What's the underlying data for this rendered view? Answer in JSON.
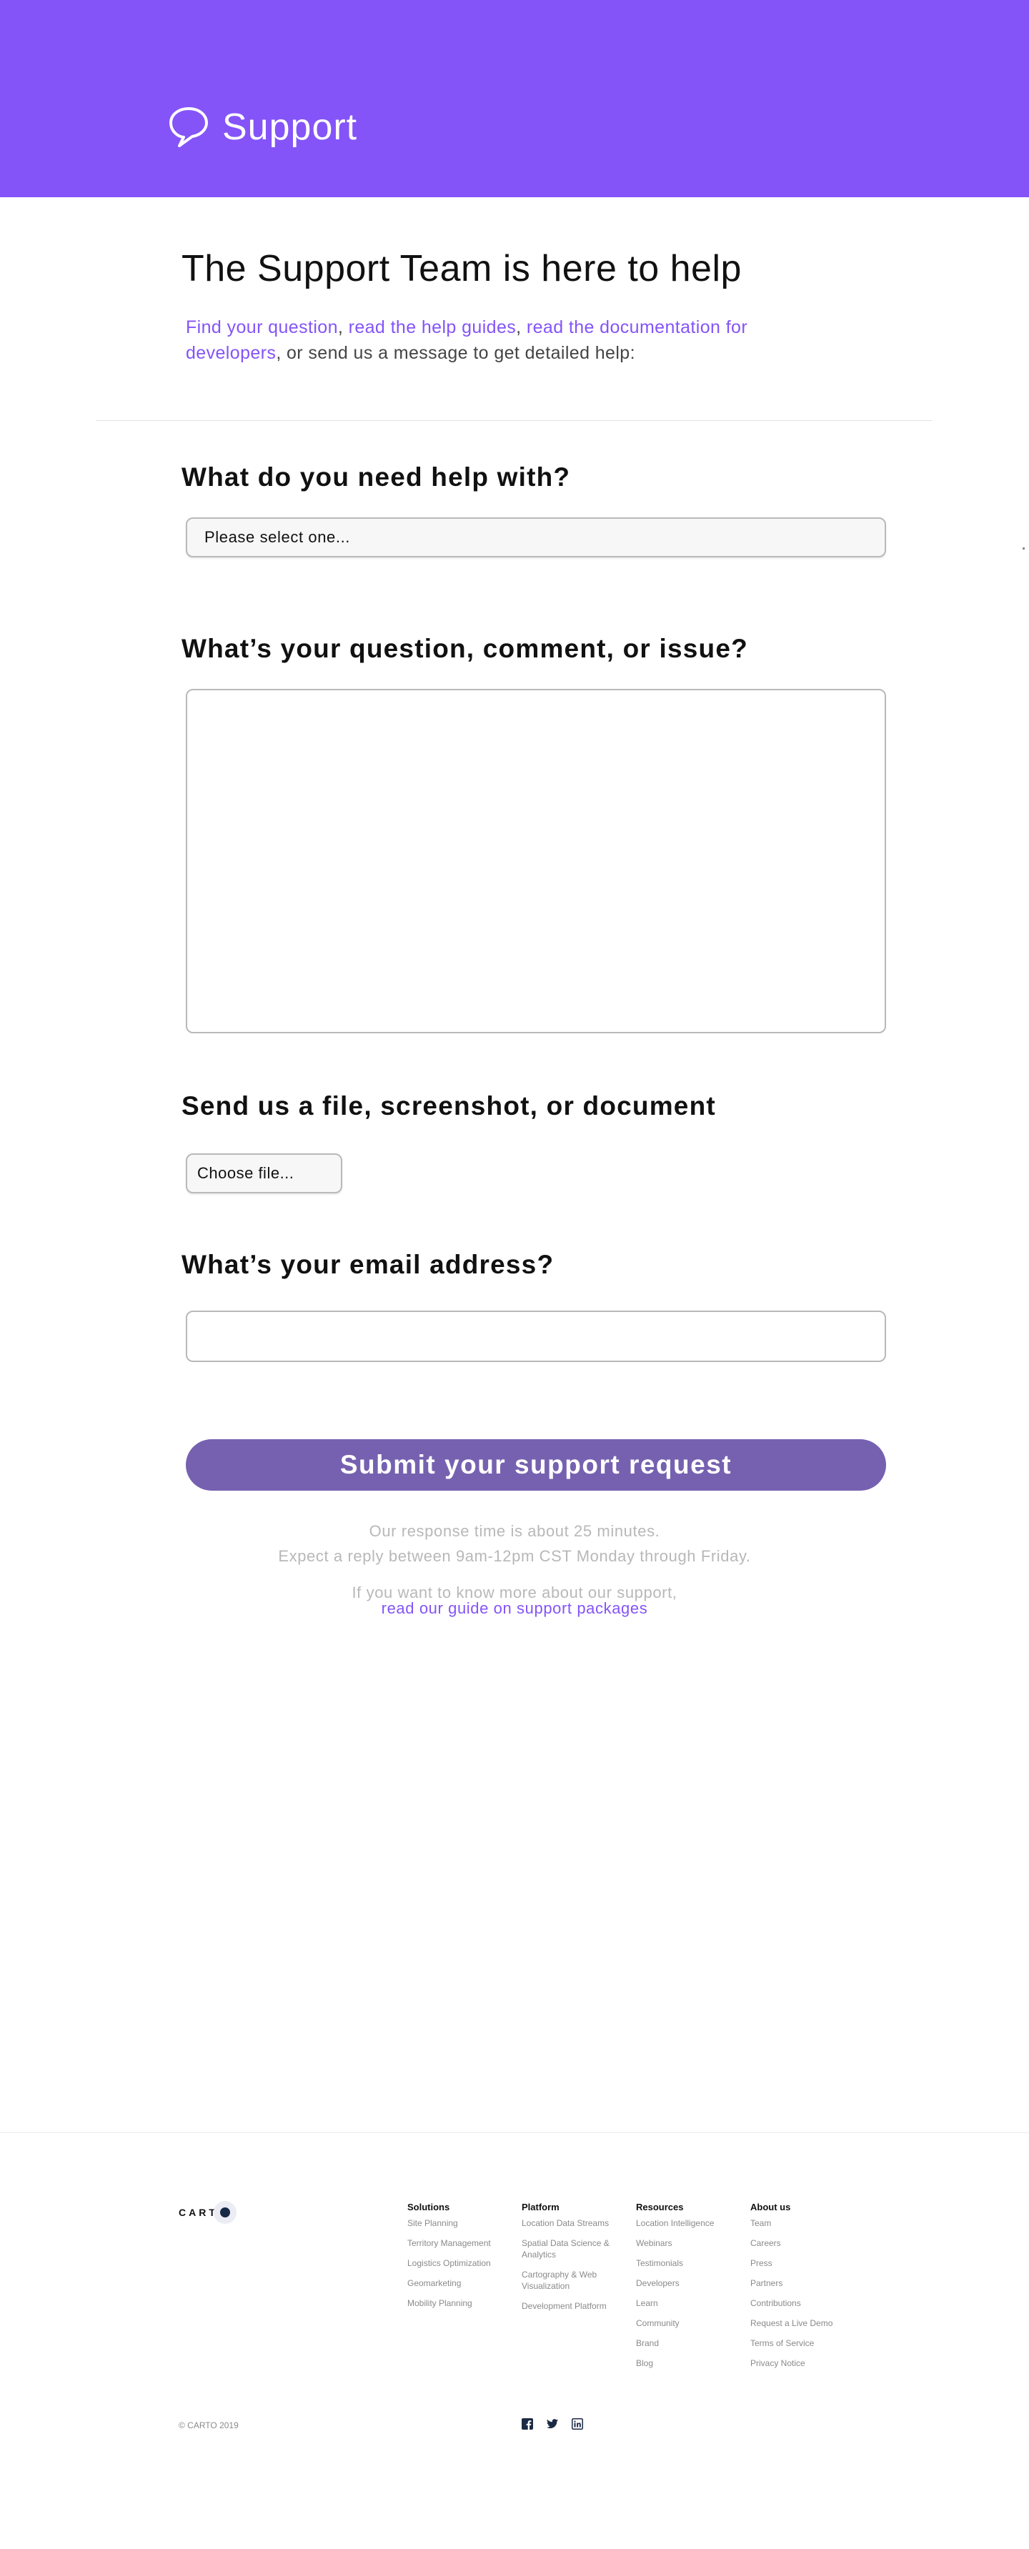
{
  "header": {
    "title": "Support",
    "bg_color": "#8454f8",
    "icon": "speech-bubble-icon"
  },
  "intro": {
    "headline": "The Support Team is here to help",
    "link_find": "Find your question",
    "sep1": ", ",
    "link_guides": "read the help guides",
    "sep2": ", ",
    "link_docs": "read the documentation for developers",
    "rest": ", or send us a message to get detailed help:"
  },
  "form": {
    "help_question": "What do you need help with?",
    "help_select_value": "Please select one...",
    "issue_question": "What’s your question, comment, or issue?",
    "file_question": "Send us a file, screenshot, or document",
    "file_button_label": "Choose file...",
    "email_question": "What’s your email address?",
    "submit_label": "Submit your support request",
    "submit_color": "#7661b0"
  },
  "notes": {
    "response_time": "Our response time is about 25 minutes.",
    "reply_window": "Expect a reply between 9am-12pm CST Monday through Friday.",
    "support_more": "If you want to know more about our support,",
    "support_link": "read our guide on support packages"
  },
  "footer": {
    "logo_text": "CART",
    "columns": [
      {
        "heading": "Solutions",
        "links": [
          "Site Planning",
          "Territory Management",
          "Logistics Optimization",
          "Geomarketing",
          "Mobility Planning"
        ]
      },
      {
        "heading": "Platform",
        "links": [
          "Location Data Streams",
          "Spatial Data Science & Analytics",
          "Cartography & Web Visualization",
          "Development Platform"
        ]
      },
      {
        "heading": "Resources",
        "links": [
          "Location Intelligence",
          "Webinars",
          "Testimonials",
          "Developers",
          "Learn",
          "Community",
          "Brand",
          "Blog"
        ]
      },
      {
        "heading": "About us",
        "links": [
          "Team",
          "Careers",
          "Press",
          "Partners",
          "Contributions",
          "Request a Live Demo",
          "Terms of Service",
          "Privacy Notice"
        ]
      }
    ],
    "copyright": "© CARTO 2019",
    "social_icons": [
      "facebook-icon",
      "twitter-icon",
      "linkedin-icon"
    ]
  },
  "colors": {
    "accent": "#8454f8",
    "muted_text": "#b8b8b8"
  }
}
